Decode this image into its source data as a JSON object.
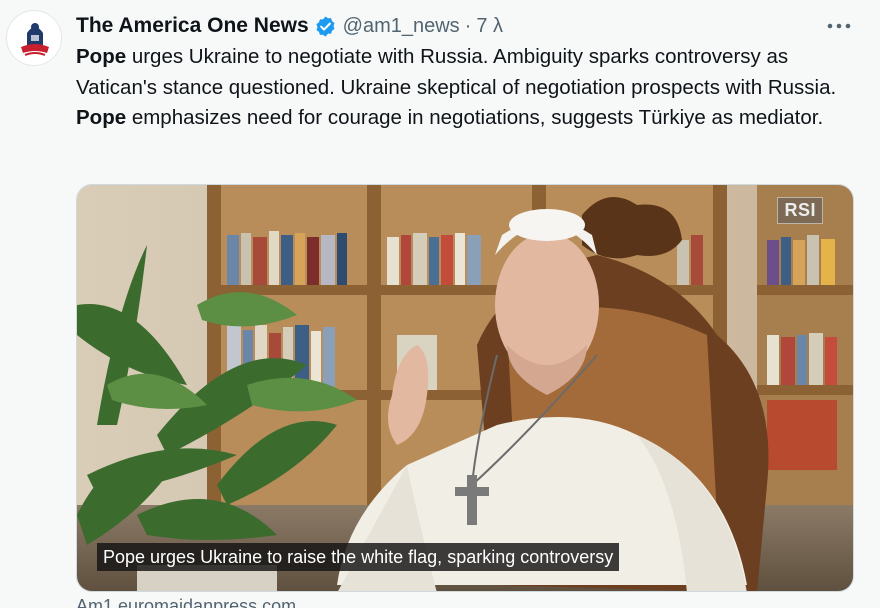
{
  "tweet": {
    "author": {
      "display_name": "The America One News",
      "handle": "@am1_news",
      "verified": true
    },
    "separator": "·",
    "timestamp": "7 λ",
    "text_segments": [
      {
        "text": "Pope",
        "bold": true
      },
      {
        "text": " urges Ukraine to negotiate with Russia. Ambiguity sparks controversy as Vatican's stance questioned. Ukraine skeptical of negotiation prospects with Russia. ",
        "bold": false
      },
      {
        "text": "Pope",
        "bold": true
      },
      {
        "text": " emphasizes need for courage in negotiations, suggests Türkiye as mediator.",
        "bold": false
      }
    ],
    "media": {
      "watermark": "RSI",
      "caption": "Pope urges Ukraine to raise the white flag, sparking controversy"
    },
    "link_domain": "Am1 euromaidanpress.com"
  },
  "icons": {
    "verified": "verified-badge-icon",
    "more": "more-options-icon"
  },
  "colors": {
    "background": "#f7f9f9",
    "text_primary": "#0f1419",
    "text_secondary": "#536471",
    "verified_blue": "#1d9bf0"
  }
}
